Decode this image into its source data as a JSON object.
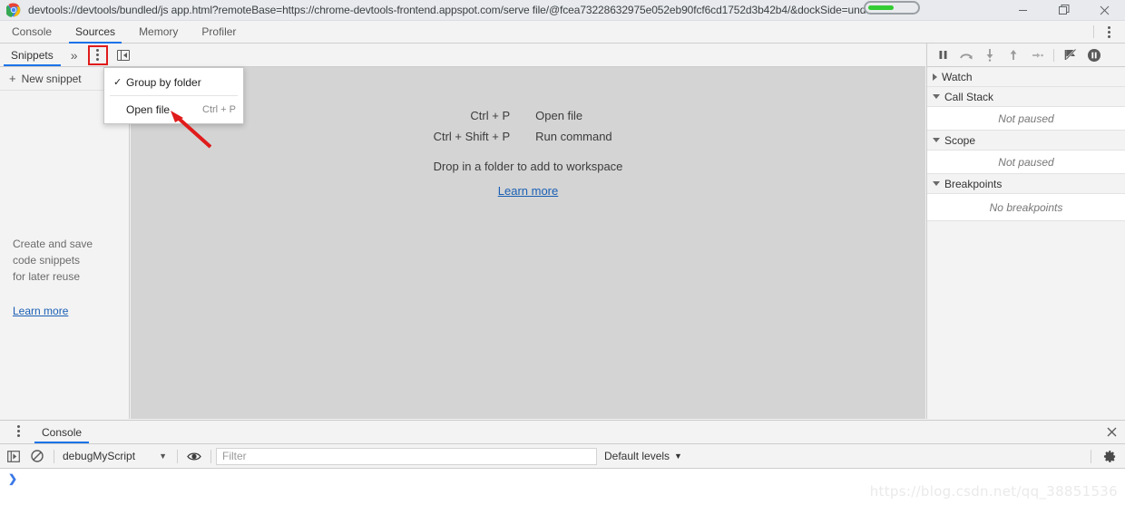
{
  "window": {
    "title": "devtools://devtools/bundled/js app.html?remoteBase=https://chrome-devtools-frontend.appspot.com/serve file/@fcea73228632975e052eb90fcf6cd1752d3b42b4/&dockSide=undocked",
    "logo_icon": "chrome-logo-icon",
    "minimize_icon": "minimize-icon",
    "restore_icon": "restore-icon",
    "close_icon": "close-icon"
  },
  "main_tabs": {
    "items": [
      {
        "label": "Console",
        "selected": false
      },
      {
        "label": "Sources",
        "selected": true
      },
      {
        "label": "Memory",
        "selected": false
      },
      {
        "label": "Profiler",
        "selected": false
      }
    ],
    "menu_icon": "more-vertical-icon"
  },
  "panel_toolbar": {
    "tabs": [
      {
        "label": "Snippets",
        "selected": true
      }
    ],
    "more_tabs_label": "»",
    "more_options_icon": "more-vertical-icon",
    "show_navigator_icon": "toggle-navigator-icon",
    "highlight_color": "#e01b1b"
  },
  "context_menu": {
    "items": [
      {
        "label": "Group by folder",
        "checked": true,
        "check_glyph": "✓",
        "accelerator": ""
      },
      {
        "label": "Open file",
        "checked": false,
        "check_glyph": "",
        "accelerator": "Ctrl + P"
      }
    ]
  },
  "navigator": {
    "new_snippet_label": "New snippet",
    "new_snippet_icon": "plus-icon",
    "empty_text_line1": "Create and save",
    "empty_text_line2": "code snippets",
    "empty_text_line3": "for later reuse",
    "learn_more_label": "Learn more",
    "link_color": "#1a5fb4"
  },
  "editor": {
    "shortcuts": [
      {
        "keys": "Ctrl + P",
        "description": "Open file"
      },
      {
        "keys": "Ctrl + Shift + P",
        "description": "Run command"
      }
    ],
    "drop_hint": "Drop in a folder to add to workspace",
    "learn_more_label": "Learn more",
    "background_color": "#d4d4d4"
  },
  "debugger": {
    "toolbar_icons": [
      "pause-icon",
      "step-over-icon",
      "step-into-icon",
      "step-out-icon",
      "step-icon",
      "deactivate-breakpoints-icon",
      "pause-on-exceptions-icon"
    ],
    "sections": [
      {
        "title": "Watch",
        "expanded": false,
        "body": ""
      },
      {
        "title": "Call Stack",
        "expanded": true,
        "body": "Not paused"
      },
      {
        "title": "Scope",
        "expanded": true,
        "body": "Not paused"
      },
      {
        "title": "Breakpoints",
        "expanded": true,
        "body": "No breakpoints"
      }
    ]
  },
  "drawer": {
    "tabs": [
      {
        "label": "Console",
        "selected": true
      }
    ],
    "menu_icon": "more-vertical-icon",
    "close_icon": "close-icon"
  },
  "console_toolbar": {
    "sidebar_icon": "show-console-sidebar-icon",
    "clear_icon": "clear-console-icon",
    "context_value": "debugMyScript",
    "context_caret": "▼",
    "eye_icon": "live-expression-icon",
    "filter_placeholder": "Filter",
    "filter_value": "",
    "levels_label": "Default levels",
    "levels_caret": "▼",
    "settings_icon": "gear-icon"
  },
  "console": {
    "prompt_glyph": "❯"
  },
  "watermark": {
    "text": "https://blog.csdn.net/qq_38851536"
  },
  "annotations": {
    "arrow_color": "#e01b1b",
    "pill_color": "#33cc33"
  }
}
